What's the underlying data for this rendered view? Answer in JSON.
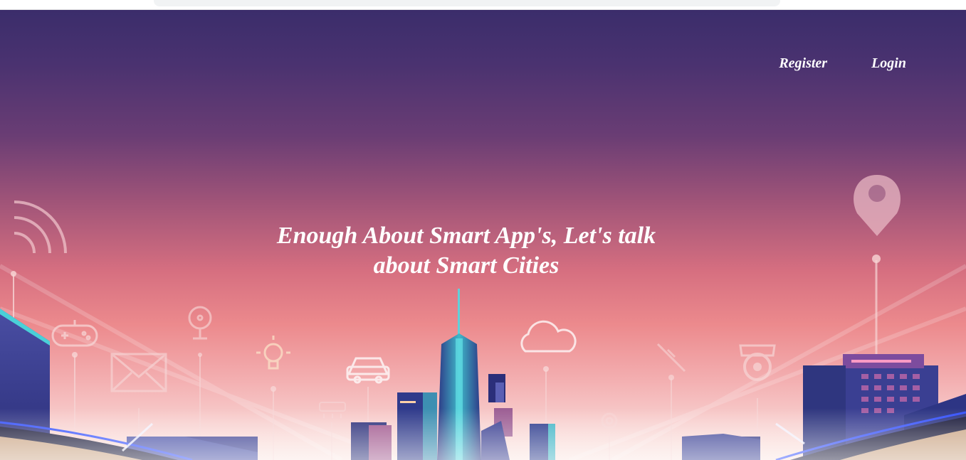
{
  "nav": {
    "register_label": "Register",
    "login_label": "Login"
  },
  "hero": {
    "headline_line1": "Enough About Smart App's, Let's talk",
    "headline_line2": "about Smart Cities"
  },
  "colors": {
    "sky_top": "#3b2d6b",
    "sky_mid": "#d66f80",
    "sky_bottom": "#fbe7e2",
    "building_dark": "#2e3a87",
    "building_teal": "#3cc6d0",
    "icon_stroke": "#f7d6d6"
  },
  "icons": [
    "wifi-icon",
    "gamepad-icon",
    "envelope-icon",
    "fan-icon",
    "lightbulb-icon",
    "car-icon",
    "cloud-icon",
    "gear-icon",
    "syringe-icon",
    "security-camera-icon",
    "map-pin-icon"
  ]
}
